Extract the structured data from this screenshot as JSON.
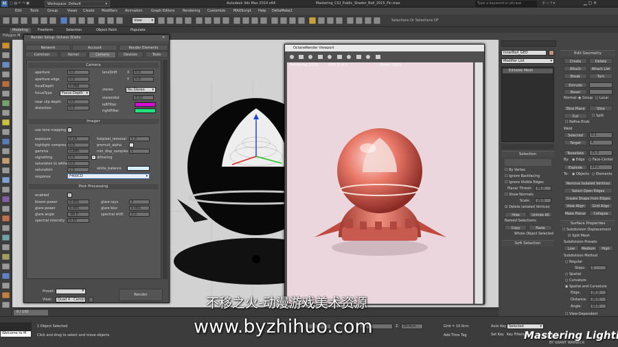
{
  "titlebar": {
    "workspace": "Workspace: Default",
    "app_title": "Autodesk 3ds Max 2014 x64",
    "file_title": "Mastering_CGI_Public_Shader_Ball_2015_Fin.max",
    "search_placeholder": "Type a keyword or phrase"
  },
  "menu": [
    "Edit",
    "Tools",
    "Group",
    "Views",
    "Create",
    "Modifiers",
    "Animation",
    "Graph Editors",
    "Rendering",
    "Customize",
    "MAXScript",
    "Help",
    "DeltaMake2"
  ],
  "toolbar": {
    "view_dropdown": "View",
    "sel_set_text": "Selections Or Selections OF"
  },
  "ribbon_tabs": [
    "Modeling",
    "Freeform",
    "Selection",
    "Object Paint",
    "Populate"
  ],
  "viewport_label": "Polygon M",
  "render_setup": {
    "title": "Render Setup: Octane 3Delio",
    "tabs_top": [
      "Network",
      "Account",
      "Render Elements"
    ],
    "tabs_bottom": [
      "Common",
      "Kernel",
      "Camera",
      "Devices",
      "Tools"
    ],
    "active_tab": "Camera",
    "camera": {
      "header": "Camera",
      "left": [
        {
          "label": "aperture",
          "value": "0.0"
        },
        {
          "label": "aperture edge",
          "value": "0.0"
        },
        {
          "label": "focalDepth",
          "value": "0.068"
        },
        {
          "label": "focusType",
          "value": "Focus Depth"
        },
        {
          "label": "near clip depth",
          "value": "0.0"
        },
        {
          "label": "distortion",
          "value": "0.0"
        }
      ],
      "right": [
        {
          "label": "lensShift",
          "x": "X",
          "xv": "0.0",
          "y": "Y",
          "yv": "0.0"
        },
        {
          "label": "stereo",
          "value": "No Stereo"
        },
        {
          "label": "stereodist",
          "value": "0.02"
        },
        {
          "label": "leftFilter"
        },
        {
          "label": "rightFilter"
        }
      ]
    },
    "imager": {
      "header": "Imager",
      "use_tone": "use tone mapping",
      "left": [
        {
          "label": "exposure",
          "value": "0.14"
        },
        {
          "label": "highlight compres.",
          "value": "0.0"
        },
        {
          "label": "gamma",
          "value": "0.685"
        },
        {
          "label": "vignetting",
          "value": "0.0"
        },
        {
          "label": "saturation to white",
          "value": "0.0"
        },
        {
          "label": "saturation",
          "value": "1.0"
        },
        {
          "label": "response",
          "value": "F400CD"
        }
      ],
      "right": [
        {
          "label": "hotpixel_removal",
          "value": "1.0"
        },
        {
          "label": "premult_alpha"
        },
        {
          "label": "min_disp_samples",
          "value": "1"
        },
        {
          "label": "dithering"
        },
        {
          "label": "white_balance"
        }
      ]
    },
    "post": {
      "header": "Post Processing",
      "enabled": "enabled",
      "left": [
        {
          "label": "bloom power",
          "value": "0.001"
        },
        {
          "label": "glare power",
          "value": "0.001"
        },
        {
          "label": "glare angle",
          "value": "-90.0"
        },
        {
          "label": "spectral intensity",
          "value": "0.15"
        }
      ],
      "right": [
        {
          "label": "glare rays",
          "value": "3"
        },
        {
          "label": "glare blur",
          "value": "0.001"
        },
        {
          "label": "spectral shift",
          "value": "2.0"
        }
      ]
    },
    "preset_label": "Preset:",
    "view_label": "View:",
    "view_value": "Quad 4 - Camer",
    "render_button": "Render"
  },
  "octane_viewport": {
    "title": "OctaneRender Viewport",
    "stat1": "Rendering 100%",
    "stat2": "GPU: 1 of 1",
    "stat3": "Zoom: 100%"
  },
  "cmd": {
    "object_name": "InnerBall_GEO",
    "modifier_list": "Modifier List",
    "stack_item": "Editable Mesh",
    "selection_header": "Selection",
    "by_vertex": "By Vertex",
    "ignore_backfacing": "Ignore Backfacing",
    "ignore_visible": "Ignore Visible Edges",
    "planar_thresh": "Planar Thresh:",
    "planar_val": "45.0",
    "show_normals": "Show Normals",
    "scale_label": "Scale:",
    "scale_val": "20.0",
    "delete_isolated": "Delete Isolated Vertices",
    "hide": "Hide",
    "unhide_all": "Unhide All",
    "named_sel": "Named Selections:",
    "copy": "Copy",
    "paste": "Paste",
    "whole_obj": "Whole Object Selected",
    "soft_sel": "Soft Selection",
    "edit_geometry": "Edit Geometry",
    "create": "Create",
    "delete": "Delete",
    "attach": "Attach",
    "attach_list": "Attach List",
    "break": "Break",
    "turn": "Turn",
    "extrude": "Extrude",
    "bevel": "Bevel",
    "normal": "Normal:",
    "group": "Group",
    "local": "Local",
    "slice_plane": "Slice Plane",
    "slice": "Slice",
    "cut": "Cut",
    "split": "Split",
    "refine_ends": "Refine Ends",
    "weld": "Weld",
    "selected": "Selected",
    "selected_val": "0.1",
    "target": "Target",
    "target_val": "4",
    "tessellate": "Tessellate",
    "tess_val": "25.0",
    "by": "By:",
    "edge": "Edge",
    "face_center": "Face-Center",
    "explode": "Explode",
    "explode_val": "24.0",
    "to": "To:",
    "objects": "Objects",
    "elements": "Elements",
    "remove_iso": "Remove Isolated Vertices",
    "sel_open": "Select Open Edges",
    "create_shape": "Create Shape from Edges",
    "view_align": "View Align",
    "grid_align": "Grid Align",
    "make_planar": "Make Planar",
    "collapse": "Collapse",
    "surface_props": "Surface Properties",
    "subdiv_disp": "Subdivision Displacement",
    "split_mesh": "Split Mesh",
    "subdiv_presets": "Subdivision Presets",
    "low": "Low",
    "medium": "Medium",
    "high": "High",
    "subdiv_method": "Subdivision Method",
    "regular": "Regular",
    "steps": "Steps:",
    "steps_val": "2",
    "spatial": "Spatial",
    "curvature": "Curvature",
    "spatial_curv": "Spatial and Curvature",
    "edge2": "Edge:",
    "edge2_val": "20.0",
    "distance": "Distance:",
    "distance_val": "20.0",
    "angle": "Angle:",
    "angle_val": "10.0",
    "view_dep": "View-Dependent"
  },
  "status": {
    "script": "Welcome to M",
    "timeline": "0 / 100",
    "selected": "1 Object Selected",
    "prompt": "Click and drag to select and move objects",
    "x": "X:",
    "y": "Y:",
    "z": "Z:",
    "zv": "29.4cm",
    "grid": "Grid = 10.0cm",
    "add_time_tag": "Add Time Tag",
    "auto_key": "Auto Key",
    "auto_key_val": "Selected",
    "set_key": "Set Key",
    "key_filters": "Key Filters...",
    "frame": "0"
  },
  "watermark": {
    "cn": "不移之火-动漫游戏美术资源",
    "url": "www.byzhihuo.com",
    "brand": "Mastering Lighting",
    "credit": "BY GRANT WARWICK"
  },
  "colors": {
    "left_filter": "#d010d0",
    "right_filter": "#20e080",
    "white_balance": "#d8eef8",
    "accent": "#4a7fc4"
  }
}
